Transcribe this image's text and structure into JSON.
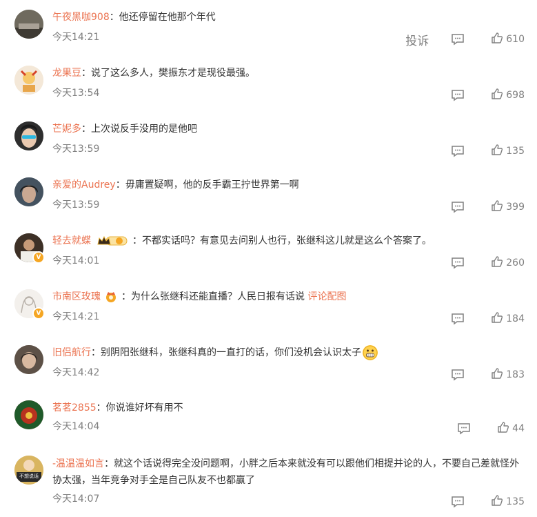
{
  "comments": [
    {
      "user": "午夜黑咖908",
      "text": "他还停留在他那个年代",
      "time": "今天14:21",
      "likes": "610",
      "report": "投诉",
      "avatar_color": "#6f6a5e"
    },
    {
      "user": "龙果豆",
      "text": "说了这么多人，樊振东才是现役最强。",
      "time": "今天13:54",
      "likes": "698",
      "avatar_color": "#f2e3cf"
    },
    {
      "user": "芒妮多",
      "text": "上次说反手没用的是他吧",
      "time": "今天13:59",
      "likes": "135",
      "avatar_color": "#3a3a3a"
    },
    {
      "user": "亲爱的Audrey",
      "text": "毋庸置疑啊，他的反手霸王拧世界第一啊",
      "time": "今天13:59",
      "likes": "399",
      "avatar_color": "#5b6a7a"
    },
    {
      "user": "轻去就蝶",
      "text": "不都实话吗？有意见去问别人也行，张继科这儿就是这么个答案了。",
      "time": "今天14:01",
      "likes": "260",
      "avatar_color": "#4b3b2e",
      "vip_level": "1"
    },
    {
      "user": "市南区玫瑰",
      "text": "为什么张继科还能直播？人民日报有话说 ",
      "link": "评论配图",
      "time": "今天14:21",
      "likes": "184",
      "avatar_color": "#ebe7e3"
    },
    {
      "user": "旧侣航行",
      "text": "别阴阳张继科，张继科真的一直打的话，你们没机会认识太子",
      "time": "今天14:42",
      "likes": "183",
      "avatar_color": "#7a6a5a"
    },
    {
      "user": "茗茗2855",
      "text": "你说谁好坏有用不",
      "time": "今天14:04",
      "likes": "44",
      "avatar_color": "#8b2a1e"
    },
    {
      "user": "-温温温如言",
      "text": "就这个话说得完全没问题啊，小胖之后本来就没有可以跟他们相提并论的人，不要自己差就怪外协太强，当年竞争对手全是自己队友不也都赢了",
      "time": "今天14:07",
      "likes": "135",
      "avatar_color": "#c8a65a",
      "avatar_label": "不想说话"
    }
  ],
  "colors": {
    "username": "#eb7350",
    "meta": "#808080",
    "text": "#333333"
  },
  "icons": [
    "comment-icon",
    "thumb-up-icon",
    "vip-crown-badge",
    "v-verified-badge",
    "emoji-grimace-icon"
  ]
}
